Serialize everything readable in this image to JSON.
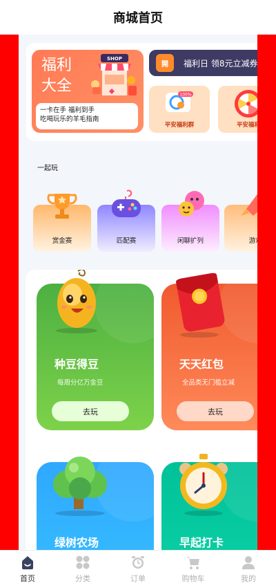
{
  "header": {
    "title": "商城首页"
  },
  "welfare": {
    "big_title": "福利大全",
    "big_subtitle": "一卡在手 福利到手\n吃喝玩乐的羊毛指南",
    "shop_sign": "SHOP",
    "announce_icon": "開",
    "announce_text": "福利日 领8元立减券",
    "mini_cards": [
      {
        "label": "平安福利群",
        "badge": "100%"
      },
      {
        "label": "平安福利"
      }
    ]
  },
  "play": {
    "title": "一起玩",
    "items": [
      {
        "label": "赏金赛",
        "icon": "trophy-icon"
      },
      {
        "label": "匹配赛",
        "icon": "gamepad-icon"
      },
      {
        "label": "闲聊扩列",
        "icon": "emoji-icon"
      },
      {
        "label": "游戏启",
        "icon": "rocket-icon"
      }
    ]
  },
  "games": [
    {
      "title": "种豆得豆",
      "desc": "每周分亿万金豆",
      "button": "去玩"
    },
    {
      "title": "天天红包",
      "desc": "全品类无门槛立减",
      "button": "去玩"
    },
    {
      "title": "绿树农场",
      "desc": "",
      "button": ""
    },
    {
      "title": "早起打卡",
      "desc": "",
      "button": ""
    }
  ],
  "tabbar": [
    {
      "label": "首页",
      "icon": "home-icon",
      "active": true
    },
    {
      "label": "分类",
      "icon": "category-icon",
      "active": false
    },
    {
      "label": "订单",
      "icon": "order-icon",
      "active": false
    },
    {
      "label": "购物车",
      "icon": "cart-icon",
      "active": false
    },
    {
      "label": "我的",
      "icon": "user-icon",
      "active": false
    }
  ],
  "colors": {
    "frame": "#ff0000",
    "content_bg": "#f3f6fb"
  }
}
